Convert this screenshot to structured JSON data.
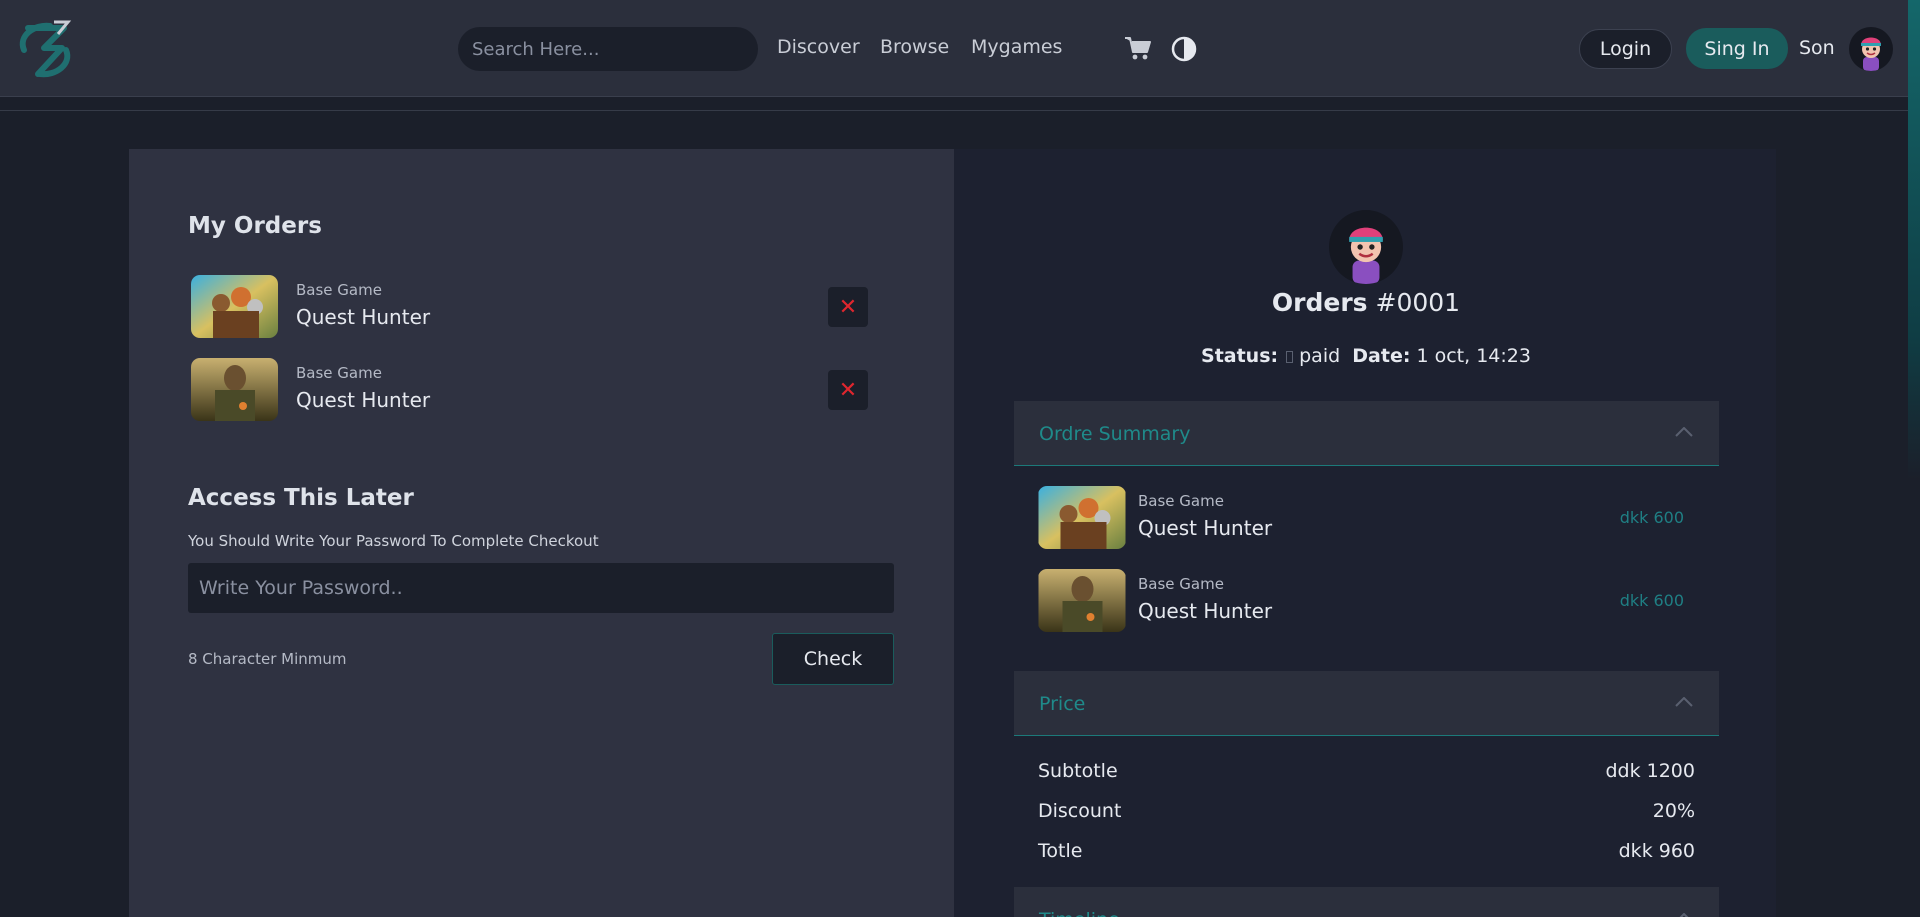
{
  "header": {
    "search_placeholder": "Search Here...",
    "nav": [
      "Discover",
      "Browse",
      "Mygames"
    ],
    "login_label": "Login",
    "signin_label": "Sing In",
    "username": "Son",
    "icons": {
      "logo": "brand-logo",
      "cart": "cart-icon",
      "theme": "theme-toggle-icon",
      "avatar": "user-avatar"
    },
    "accent_color": "#1a5c5c"
  },
  "left": {
    "my_orders_title": "My Orders",
    "orders": [
      {
        "type": "Base Game",
        "name": "Quest Hunter"
      },
      {
        "type": "Base Game",
        "name": "Quest Hunter"
      }
    ],
    "remove_symbol": "✕",
    "access_title": "Access This Later",
    "helper": "You Should Write Your Password To Complete Checkout",
    "password_placeholder": "Write Your Password..",
    "min_text": "8 Character Minmum",
    "check_label": "Check"
  },
  "right": {
    "order_label": "Orders",
    "order_number": "#0001",
    "status_label": "Status:",
    "status_value": "paid",
    "date_label": "Date:",
    "date_value": "1 oct, 14:23",
    "summary_title": "Ordre Summary",
    "summary_items": [
      {
        "type": "Base Game",
        "name": "Quest Hunter",
        "price": "dkk 600"
      },
      {
        "type": "Base Game",
        "name": "Quest Hunter",
        "price": "dkk 600"
      }
    ],
    "price_title": "Price",
    "price_rows": [
      {
        "label": "Subtotle",
        "value": "ddk 1200"
      },
      {
        "label": "Discount",
        "value": "20%"
      },
      {
        "label": "Totle",
        "value": "dkk 960"
      }
    ],
    "timeline_title": "Timeline"
  }
}
